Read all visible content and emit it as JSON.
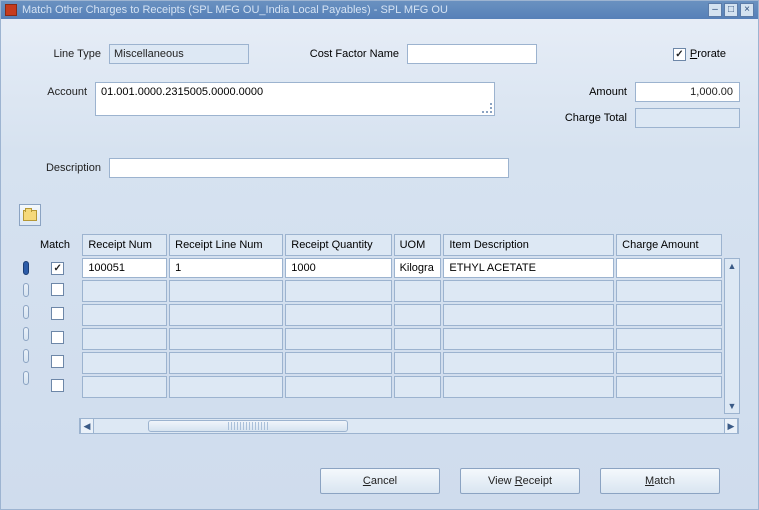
{
  "title": "Match Other Charges to Receipts (SPL MFG OU_India Local Payables) - SPL MFG OU",
  "form": {
    "line_type_label": "Line Type",
    "line_type_value": "Miscellaneous",
    "cost_factor_label": "Cost Factor Name",
    "cost_factor_value": "",
    "prorate_label": "Prorate",
    "prorate_checked": true,
    "account_label": "Account",
    "account_value": "01.001.0000.2315005.0000.0000",
    "amount_label": "Amount",
    "amount_value": "1,000.00",
    "charge_total_label": "Charge Total",
    "charge_total_value": "",
    "description_label": "Description",
    "description_value": ""
  },
  "grid": {
    "match_header": "Match",
    "columns": [
      "Receipt Num",
      "Receipt Line Num",
      "Receipt Quantity",
      "UOM",
      "Item Description",
      "Charge Amount"
    ],
    "rows": [
      {
        "match": true,
        "receipt_num": "100051",
        "receipt_line_num": "1",
        "receipt_qty": "1000",
        "uom": "Kilogram",
        "item_desc": "ETHYL ACETATE",
        "charge_amt": ""
      },
      {
        "match": false,
        "receipt_num": "",
        "receipt_line_num": "",
        "receipt_qty": "",
        "uom": "",
        "item_desc": "",
        "charge_amt": ""
      },
      {
        "match": false,
        "receipt_num": "",
        "receipt_line_num": "",
        "receipt_qty": "",
        "uom": "",
        "item_desc": "",
        "charge_amt": ""
      },
      {
        "match": false,
        "receipt_num": "",
        "receipt_line_num": "",
        "receipt_qty": "",
        "uom": "",
        "item_desc": "",
        "charge_amt": ""
      },
      {
        "match": false,
        "receipt_num": "",
        "receipt_line_num": "",
        "receipt_qty": "",
        "uom": "",
        "item_desc": "",
        "charge_amt": ""
      },
      {
        "match": false,
        "receipt_num": "",
        "receipt_line_num": "",
        "receipt_qty": "",
        "uom": "",
        "item_desc": "",
        "charge_amt": ""
      }
    ]
  },
  "buttons": {
    "cancel": "Cancel",
    "view_receipt": "View Receipt",
    "match": "Match"
  }
}
